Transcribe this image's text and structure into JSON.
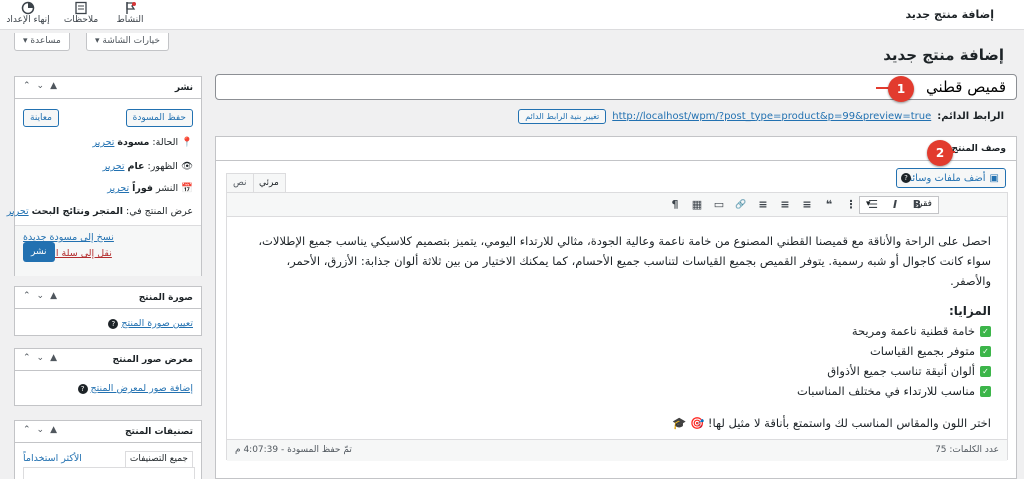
{
  "topbar": {
    "items": [
      {
        "label": "إنهاء الإعداد",
        "icon": "progress-circle-icon"
      },
      {
        "label": "ملاحظات",
        "icon": "notes-icon"
      },
      {
        "label": "النشاط",
        "icon": "activity-flag-icon"
      }
    ],
    "page_heading": "إضافة منتج جديد"
  },
  "screen_buttons": {
    "options": "خيارات الشاشة ▾",
    "help": "مساعدة ▾"
  },
  "page_title": "إضافة منتج جديد",
  "product_title": {
    "value": "قميص قطني",
    "marker": "1"
  },
  "permalink": {
    "label": "الرابط الدائم:",
    "url": "http://localhost/wpm/?post_type=product&p=99&preview=true",
    "change_button": "تغيير بنية الرابط الدائم"
  },
  "editor": {
    "title": "وصف المنتج",
    "marker": "2",
    "add_media": "أضف ملفات وسائط",
    "help": "?",
    "tabs": {
      "visual": "مرئي",
      "text": "نص"
    },
    "format_select": "فقرة",
    "format_arrow": "▾",
    "toolbar_icons": {
      "bold": "B",
      "italic": "I",
      "ul": "☰",
      "ol": "⋮",
      "quote": "❝",
      "align_left": "≡",
      "align_center": "≡",
      "align_right": "≡",
      "link": "🔗",
      "more": "▭",
      "toolbar_toggle": "▦",
      "paragraph": "¶"
    },
    "intro": "احصل على الراحة والأناقة مع قميصنا القطني المصنوع من خامة ناعمة وعالية الجودة، مثالي للارتداء اليومي، يتميز بتصميم كلاسيكي يناسب جميع الإطلالات، سواء كانت كاجوال أو شبه رسمية. يتوفر القميص بجميع القياسات لتناسب جميع الأحسام، كما يمكنك الاختيار من بين ثلاثة ألوان جذابة: الأزرق، الأحمر، والأصفر.",
    "benefits_heading": "المزايا:",
    "benefits": [
      "خامة قطنية ناعمة ومريحة",
      "متوفر بجميع القياسات",
      "ألوان أنيقة تناسب جميع الأذواق",
      "مناسب للارتداء في مختلف المناسبات"
    ],
    "outro": "اختر اللون والمقاس المناسب لك واستمتع بأناقة لا مثيل لها! 🎯 🎓",
    "word_count": "عدد الكلمات: 75",
    "saved": "تمّ حفظ المسودة - 4:07:39 م"
  },
  "publish": {
    "title": "نشر",
    "save_draft": "حفظ المسودة",
    "preview": "معاينة",
    "status_label": "الحالة:",
    "status_value": "مسودة",
    "visibility_label": "الظهور:",
    "visibility_value": "عام",
    "publish_label": "النشر",
    "publish_value": "فوراً",
    "catalog_label": "عرض المنتج في:",
    "catalog_value": "المتجر ونتائج البحث",
    "edit": "تحرير",
    "copy_draft": "نسخ إلى مسودة جديدة",
    "trash": "نقل إلى سلة المُهملات",
    "publish_button": "نشر"
  },
  "product_image": {
    "title": "صورة المنتج",
    "link": "تعيين صورة المنتج"
  },
  "gallery": {
    "title": "معرض صور المنتج",
    "link": "إضافة صور لمعرض المنتج"
  },
  "categories": {
    "title": "تصنيفات المنتج",
    "tab_all": "جميع التصنيفات",
    "tab_popular": "الأكثر استخداماً"
  },
  "arrows": {
    "up": "⌃",
    "down": "⌄",
    "toggle": "▲"
  },
  "colors": {
    "primary": "#2271b1",
    "marker": "#e23b2e",
    "check": "#3cb54a",
    "trash": "#b32d2e"
  }
}
